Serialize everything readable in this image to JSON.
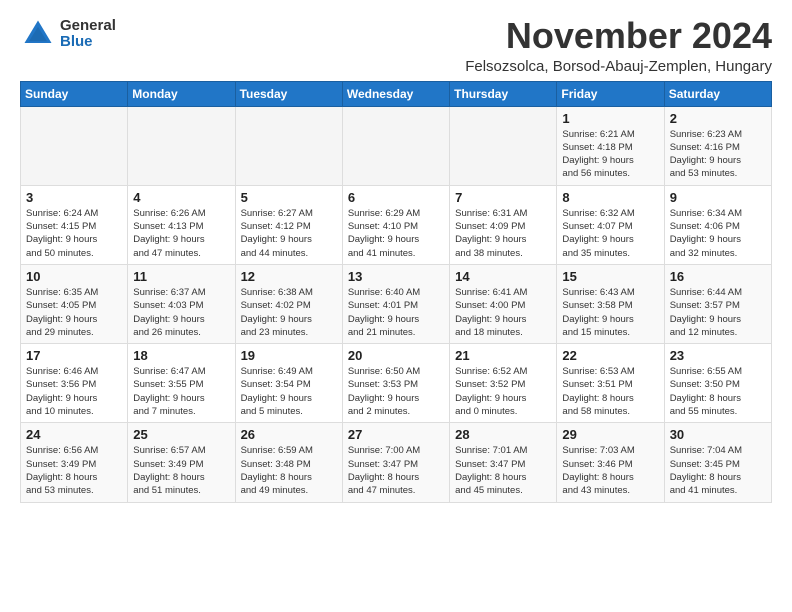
{
  "logo": {
    "general": "General",
    "blue": "Blue"
  },
  "title": "November 2024",
  "location": "Felsozsolca, Borsod-Abauj-Zemplen, Hungary",
  "headers": [
    "Sunday",
    "Monday",
    "Tuesday",
    "Wednesday",
    "Thursday",
    "Friday",
    "Saturday"
  ],
  "weeks": [
    [
      {
        "day": "",
        "info": ""
      },
      {
        "day": "",
        "info": ""
      },
      {
        "day": "",
        "info": ""
      },
      {
        "day": "",
        "info": ""
      },
      {
        "day": "",
        "info": ""
      },
      {
        "day": "1",
        "info": "Sunrise: 6:21 AM\nSunset: 4:18 PM\nDaylight: 9 hours\nand 56 minutes."
      },
      {
        "day": "2",
        "info": "Sunrise: 6:23 AM\nSunset: 4:16 PM\nDaylight: 9 hours\nand 53 minutes."
      }
    ],
    [
      {
        "day": "3",
        "info": "Sunrise: 6:24 AM\nSunset: 4:15 PM\nDaylight: 9 hours\nand 50 minutes."
      },
      {
        "day": "4",
        "info": "Sunrise: 6:26 AM\nSunset: 4:13 PM\nDaylight: 9 hours\nand 47 minutes."
      },
      {
        "day": "5",
        "info": "Sunrise: 6:27 AM\nSunset: 4:12 PM\nDaylight: 9 hours\nand 44 minutes."
      },
      {
        "day": "6",
        "info": "Sunrise: 6:29 AM\nSunset: 4:10 PM\nDaylight: 9 hours\nand 41 minutes."
      },
      {
        "day": "7",
        "info": "Sunrise: 6:31 AM\nSunset: 4:09 PM\nDaylight: 9 hours\nand 38 minutes."
      },
      {
        "day": "8",
        "info": "Sunrise: 6:32 AM\nSunset: 4:07 PM\nDaylight: 9 hours\nand 35 minutes."
      },
      {
        "day": "9",
        "info": "Sunrise: 6:34 AM\nSunset: 4:06 PM\nDaylight: 9 hours\nand 32 minutes."
      }
    ],
    [
      {
        "day": "10",
        "info": "Sunrise: 6:35 AM\nSunset: 4:05 PM\nDaylight: 9 hours\nand 29 minutes."
      },
      {
        "day": "11",
        "info": "Sunrise: 6:37 AM\nSunset: 4:03 PM\nDaylight: 9 hours\nand 26 minutes."
      },
      {
        "day": "12",
        "info": "Sunrise: 6:38 AM\nSunset: 4:02 PM\nDaylight: 9 hours\nand 23 minutes."
      },
      {
        "day": "13",
        "info": "Sunrise: 6:40 AM\nSunset: 4:01 PM\nDaylight: 9 hours\nand 21 minutes."
      },
      {
        "day": "14",
        "info": "Sunrise: 6:41 AM\nSunset: 4:00 PM\nDaylight: 9 hours\nand 18 minutes."
      },
      {
        "day": "15",
        "info": "Sunrise: 6:43 AM\nSunset: 3:58 PM\nDaylight: 9 hours\nand 15 minutes."
      },
      {
        "day": "16",
        "info": "Sunrise: 6:44 AM\nSunset: 3:57 PM\nDaylight: 9 hours\nand 12 minutes."
      }
    ],
    [
      {
        "day": "17",
        "info": "Sunrise: 6:46 AM\nSunset: 3:56 PM\nDaylight: 9 hours\nand 10 minutes."
      },
      {
        "day": "18",
        "info": "Sunrise: 6:47 AM\nSunset: 3:55 PM\nDaylight: 9 hours\nand 7 minutes."
      },
      {
        "day": "19",
        "info": "Sunrise: 6:49 AM\nSunset: 3:54 PM\nDaylight: 9 hours\nand 5 minutes."
      },
      {
        "day": "20",
        "info": "Sunrise: 6:50 AM\nSunset: 3:53 PM\nDaylight: 9 hours\nand 2 minutes."
      },
      {
        "day": "21",
        "info": "Sunrise: 6:52 AM\nSunset: 3:52 PM\nDaylight: 9 hours\nand 0 minutes."
      },
      {
        "day": "22",
        "info": "Sunrise: 6:53 AM\nSunset: 3:51 PM\nDaylight: 8 hours\nand 58 minutes."
      },
      {
        "day": "23",
        "info": "Sunrise: 6:55 AM\nSunset: 3:50 PM\nDaylight: 8 hours\nand 55 minutes."
      }
    ],
    [
      {
        "day": "24",
        "info": "Sunrise: 6:56 AM\nSunset: 3:49 PM\nDaylight: 8 hours\nand 53 minutes."
      },
      {
        "day": "25",
        "info": "Sunrise: 6:57 AM\nSunset: 3:49 PM\nDaylight: 8 hours\nand 51 minutes."
      },
      {
        "day": "26",
        "info": "Sunrise: 6:59 AM\nSunset: 3:48 PM\nDaylight: 8 hours\nand 49 minutes."
      },
      {
        "day": "27",
        "info": "Sunrise: 7:00 AM\nSunset: 3:47 PM\nDaylight: 8 hours\nand 47 minutes."
      },
      {
        "day": "28",
        "info": "Sunrise: 7:01 AM\nSunset: 3:47 PM\nDaylight: 8 hours\nand 45 minutes."
      },
      {
        "day": "29",
        "info": "Sunrise: 7:03 AM\nSunset: 3:46 PM\nDaylight: 8 hours\nand 43 minutes."
      },
      {
        "day": "30",
        "info": "Sunrise: 7:04 AM\nSunset: 3:45 PM\nDaylight: 8 hours\nand 41 minutes."
      }
    ]
  ]
}
